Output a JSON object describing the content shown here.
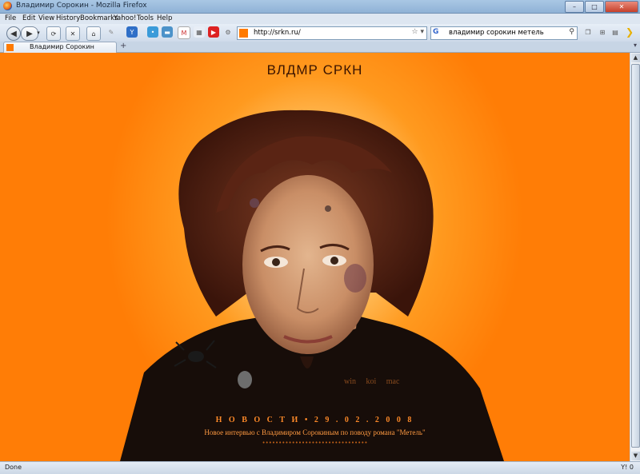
{
  "window": {
    "title": "Владимир Сорокин - Mozilla Firefox"
  },
  "menu": [
    "File",
    "Edit",
    "View",
    "History",
    "Bookmarks",
    "Yahoo!",
    "Tools",
    "Help"
  ],
  "navbar": {
    "url": "http://srkn.ru/",
    "search_query": "владимир сорокин метель"
  },
  "tab": {
    "label": "Владимир Сорокин",
    "new_tab": "+"
  },
  "page": {
    "title": "ВЛДМР СРКН",
    "encodings": [
      "win",
      "koi",
      "mac"
    ],
    "news_heading": "Н О В О С Т И • 2 9 . 0 2 . 2 0 0 8",
    "news_line": "Новое интервью с Владимиром Сорокиным по поводу романа \"Метель\"",
    "news_dots": "••••••••••••••••••••••••••••••••"
  },
  "status": {
    "text": "Done",
    "right": "0"
  },
  "colors": {
    "page_bg": "#ff7d06",
    "glow": "#ffe7b0",
    "title_text": "#3a1400"
  }
}
